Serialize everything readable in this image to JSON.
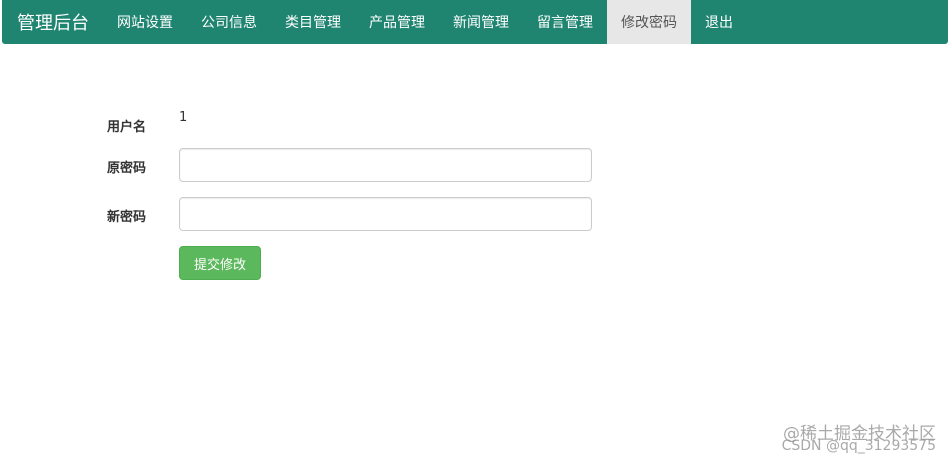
{
  "navbar": {
    "brand": "管理后台",
    "items": [
      {
        "label": "网站设置",
        "active": false
      },
      {
        "label": "公司信息",
        "active": false
      },
      {
        "label": "类目管理",
        "active": false
      },
      {
        "label": "产品管理",
        "active": false
      },
      {
        "label": "新闻管理",
        "active": false
      },
      {
        "label": "留言管理",
        "active": false
      },
      {
        "label": "修改密码",
        "active": true
      },
      {
        "label": "退出",
        "active": false
      }
    ],
    "colors": {
      "background": "#1f8470",
      "active_background": "#e7e7e7"
    }
  },
  "form": {
    "username_label": "用户名",
    "username_value": "1",
    "old_password_label": "原密码",
    "old_password_value": "",
    "new_password_label": "新密码",
    "new_password_value": "",
    "submit_label": "提交修改",
    "submit_color": "#5cb85c"
  },
  "watermark": {
    "line1": "@稀土掘金技术社区",
    "line2": "CSDN @qq_31293575"
  }
}
